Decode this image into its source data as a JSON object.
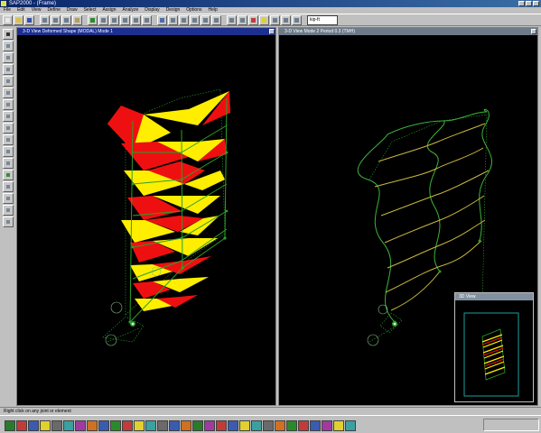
{
  "window": {
    "title": "SAP2000 - (Frame)"
  },
  "menu": [
    "File",
    "Edit",
    "View",
    "Define",
    "Draw",
    "Select",
    "Assign",
    "Analyze",
    "Display",
    "Design",
    "Options",
    "Help"
  ],
  "toolbar": {
    "units_selector": "kip-ft"
  },
  "viewports": {
    "left": {
      "title": "3-D View  Deformed Shape  (MODAL)  Mode 1",
      "active": true
    },
    "right": {
      "title": "3-D View  Mode 2  Period 0.3 (TMH)",
      "active": false
    }
  },
  "inset": {
    "title": "3D View"
  },
  "status": {
    "text": "Right click on any joint or element"
  },
  "colors": {
    "red": "#ee1010",
    "yellow": "#ffee00",
    "green": "#2aa12a",
    "viewport_bg": "#000000"
  }
}
